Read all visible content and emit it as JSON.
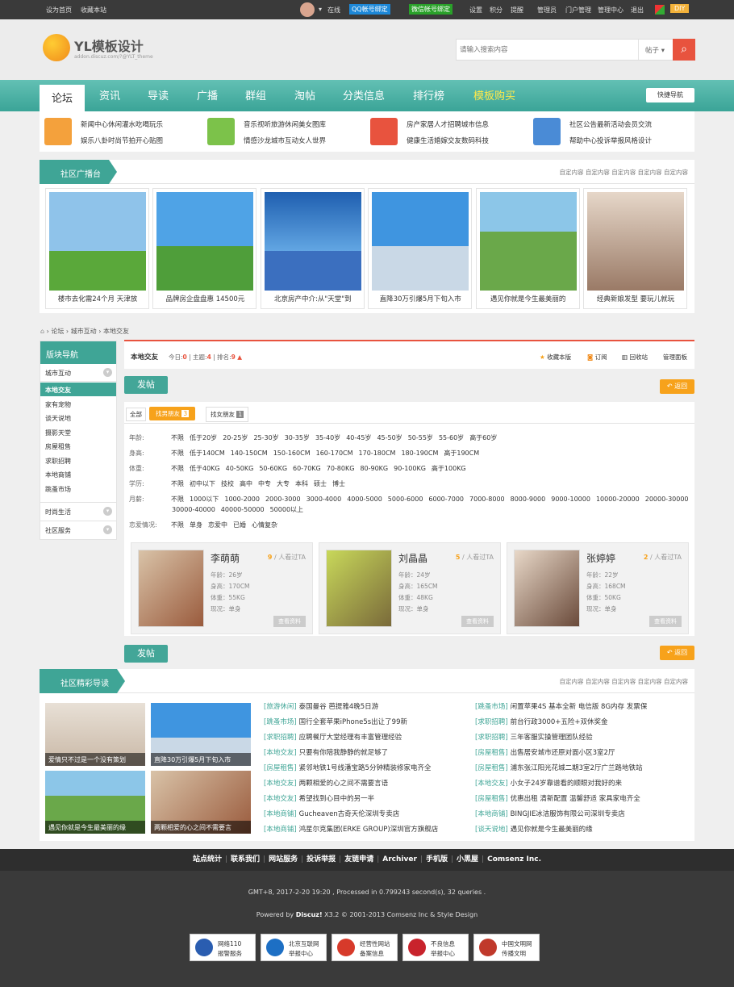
{
  "topbar": {
    "set_home": "设为首页",
    "bookmark": "收藏本站",
    "online": "在线",
    "qq_bind": "QQ帐号绑定",
    "wx_bind": "微信帐号绑定",
    "settings": "设置",
    "points": "积分",
    "remind": "提醒",
    "manager": "管理员",
    "portal_admin": "门户管理",
    "admin_center": "管理中心",
    "logout": "退出",
    "diy": "DIY"
  },
  "header": {
    "logo_text": "YL模板设计",
    "logo_sub": "addon.discuz.com/?@YLT_theme",
    "search_placeholder": "请输入搜索内容",
    "search_type": "帖子"
  },
  "nav": {
    "items": [
      "论坛",
      "资讯",
      "导读",
      "广播",
      "群组",
      "淘帖",
      "分类信息",
      "排行榜",
      "模板购买"
    ],
    "quick": "快捷导航"
  },
  "subnav": {
    "group1": [
      "新闻中心",
      "休闲灌水",
      "吃喝玩乐",
      "娱乐八卦",
      "时尚节拍",
      "开心贴图"
    ],
    "group2": [
      "音乐视听",
      "旅游休闲",
      "美女图库",
      "情感沙龙",
      "城市互动",
      "女人世界"
    ],
    "group3": [
      "房产家居",
      "人才招聘",
      "城市信息",
      "健康生活",
      "婚嫁交友",
      "数码科技"
    ],
    "group4": [
      "社区公告",
      "最新活动",
      "会员交流",
      "帮助中心",
      "投诉举报",
      "风格设计"
    ]
  },
  "broadcast": {
    "title": "社区广播台",
    "customs": "自定内容 自定内容 自定内容 自定内容 自定内容",
    "captions": [
      "楼市去化需24个月 天津放",
      "品牌房企盘盘惠 14500元",
      "北京房产中介:从\"天堂\"到",
      "直降30万引爆5月下旬入市",
      "遇见你就是今生最美丽的",
      "经典新娘发型 要玩儿就玩"
    ]
  },
  "crumb": {
    "forum": "论坛",
    "city": "城市互动",
    "current": "本地交友"
  },
  "sidebar": {
    "title": "版块导航",
    "city": "城市互动",
    "items": [
      "本地交友",
      "家有宠物",
      "谈天说地",
      "摄影天堂",
      "房屋租售",
      "求职招聘",
      "本地商铺",
      "跳蚤市场"
    ],
    "fashion": "时尚生活",
    "service": "社区服务"
  },
  "forumbar": {
    "name": "本地交友",
    "today_label": "今日:",
    "today": "0",
    "topic_label": "主题:",
    "topics": "4",
    "rank_label": "排名:",
    "rank": "9",
    "fav": "收藏本版",
    "rss": "订阅",
    "recycle": "回收站",
    "admin": "管理面板"
  },
  "actions": {
    "post": "发帖",
    "back": "返回"
  },
  "tabs": {
    "all": "全部",
    "male": "找男朋友",
    "male_count": "3",
    "female": "找女朋友",
    "female_count": "1"
  },
  "filters": [
    {
      "label": "年龄:",
      "opts": [
        "不限",
        "低于20岁",
        "20-25岁",
        "25-30岁",
        "30-35岁",
        "35-40岁",
        "40-45岁",
        "45-50岁",
        "50-55岁",
        "55-60岁",
        "高于60岁"
      ]
    },
    {
      "label": "身高:",
      "opts": [
        "不限",
        "低于140CM",
        "140-150CM",
        "150-160CM",
        "160-170CM",
        "170-180CM",
        "180-190CM",
        "高于190CM"
      ]
    },
    {
      "label": "体重:",
      "opts": [
        "不限",
        "低于40KG",
        "40-50KG",
        "50-60KG",
        "60-70KG",
        "70-80KG",
        "80-90KG",
        "90-100KG",
        "高于100KG"
      ]
    },
    {
      "label": "学历:",
      "opts": [
        "不限",
        "初中以下",
        "技校",
        "高中",
        "中专",
        "大专",
        "本科",
        "硕士",
        "博士"
      ]
    },
    {
      "label": "月薪:",
      "opts": [
        "不限",
        "1000以下",
        "1000-2000",
        "2000-3000",
        "3000-4000",
        "4000-5000",
        "5000-6000",
        "6000-7000",
        "7000-8000",
        "8000-9000",
        "9000-10000",
        "10000-20000",
        "20000-30000"
      ]
    },
    {
      "label": "",
      "opts": [
        "30000-40000",
        "40000-50000",
        "50000以上"
      ]
    },
    {
      "label": "恋爱情况:",
      "opts": [
        "不限",
        "单身",
        "恋爱中",
        "已婚",
        "心情复杂"
      ]
    }
  ],
  "persons": [
    {
      "name": "李萌萌",
      "count": "9",
      "count_label": " / 人看过TA",
      "age": "年龄：26岁",
      "height": "身高：170CM",
      "weight": "体重：55KG",
      "status": "现况：单身",
      "btn": "查看资料"
    },
    {
      "name": "刘晶晶",
      "count": "5",
      "count_label": " / 人看过TA",
      "age": "年龄：24岁",
      "height": "身高：165CM",
      "weight": "体重：48KG",
      "status": "现况：单身",
      "btn": "查看资料"
    },
    {
      "name": "张婷婷",
      "count": "2",
      "count_label": " / 人看过TA",
      "age": "年龄：22岁",
      "height": "身高：168CM",
      "weight": "体重：50KG",
      "status": "现况：单身",
      "btn": "查看资料"
    }
  ],
  "guide": {
    "title": "社区精彩导读",
    "customs": "自定内容 自定内容 自定内容 自定内容 自定内容",
    "pics": [
      "爱情只不过是一个没有策划",
      "直降30万引爆5月下旬入市",
      "遇见你就是今生最美丽的缘",
      "两颗相爱的心之间不需要言"
    ],
    "left": [
      [
        "[旅游休闲]",
        "泰国曼谷 芭提雅4晚5日游"
      ],
      [
        "[跳蚤市场]",
        "国行全套苹果iPhone5s出让了99新"
      ],
      [
        "[求职招聘]",
        "应聘餐厅大堂经理有丰富管理经验"
      ],
      [
        "[本地交友]",
        "只要有你陪我静静的就足够了"
      ],
      [
        "[房屋租售]",
        "紧邻地铁1号线潘宝路5分钟精装修家电齐全"
      ],
      [
        "[本地交友]",
        "两颗相爱的心之间不需要言语"
      ],
      [
        "[本地交友]",
        "希望找到心目中的另一半"
      ],
      [
        "[本地商铺]",
        "Gucheaven古奇天伦深圳专卖店"
      ],
      [
        "[本地商铺]",
        "鸿星尔克集团(ERKE GROUP)深圳官方旗舰店"
      ]
    ],
    "right": [
      [
        "[跳蚤市场]",
        "闲置苹果4S 基本全新 电信版 8G内存 发票保"
      ],
      [
        "[求职招聘]",
        "前台行政3000+五险+双休奖金"
      ],
      [
        "[求职招聘]",
        "三年客服实操管理团队经验"
      ],
      [
        "[房屋租售]",
        "出售居安城市还原对面小区3室2厅"
      ],
      [
        "[房屋租售]",
        "浦东张江阳光花城二期3室2厅广兰路地铁站"
      ],
      [
        "[本地交友]",
        "小女子24岁靠谱看的顺眼对我好的来"
      ],
      [
        "[房屋租售]",
        "优惠出租 清新配置 温馨舒适 家具家电齐全"
      ],
      [
        "[本地商铺]",
        "BINGJIE冰洁服饰有限公司深圳专卖店"
      ],
      [
        "[谈天说地]",
        "遇见你就是今生最美丽的缘"
      ]
    ]
  },
  "footer": {
    "links": [
      "站点统计",
      "联系我们",
      "网站服务",
      "投诉举报",
      "友链申请",
      "Archiver",
      "手机版",
      "小黑屋",
      "Comsenz Inc."
    ],
    "gmt": "GMT+8, 2017-2-20 19:20 , Processed in 0.799243 second(s), 32 queries .",
    "powered_prefix": "Powered by ",
    "powered_brand": "Discuz!",
    "powered_rest": " X3.2 © 2001-2013 Comsenz Inc & Style Design",
    "badges": [
      {
        "t1": "网络110",
        "t2": "报警服务",
        "color": "#2a5db0"
      },
      {
        "t1": "北京互联网",
        "t2": "举报中心",
        "color": "#1d6fc4"
      },
      {
        "t1": "经营性网站",
        "t2": "备案信息",
        "color": "#d73a2a"
      },
      {
        "t1": "不良信息",
        "t2": "举报中心",
        "color": "#c8232c"
      },
      {
        "t1": "中国文明网",
        "t2": "传播文明",
        "color": "#c0392b"
      }
    ]
  },
  "colors": {
    "accent": "#3fa596",
    "orange": "#f7a21b",
    "dark": "#3a3a3a"
  }
}
